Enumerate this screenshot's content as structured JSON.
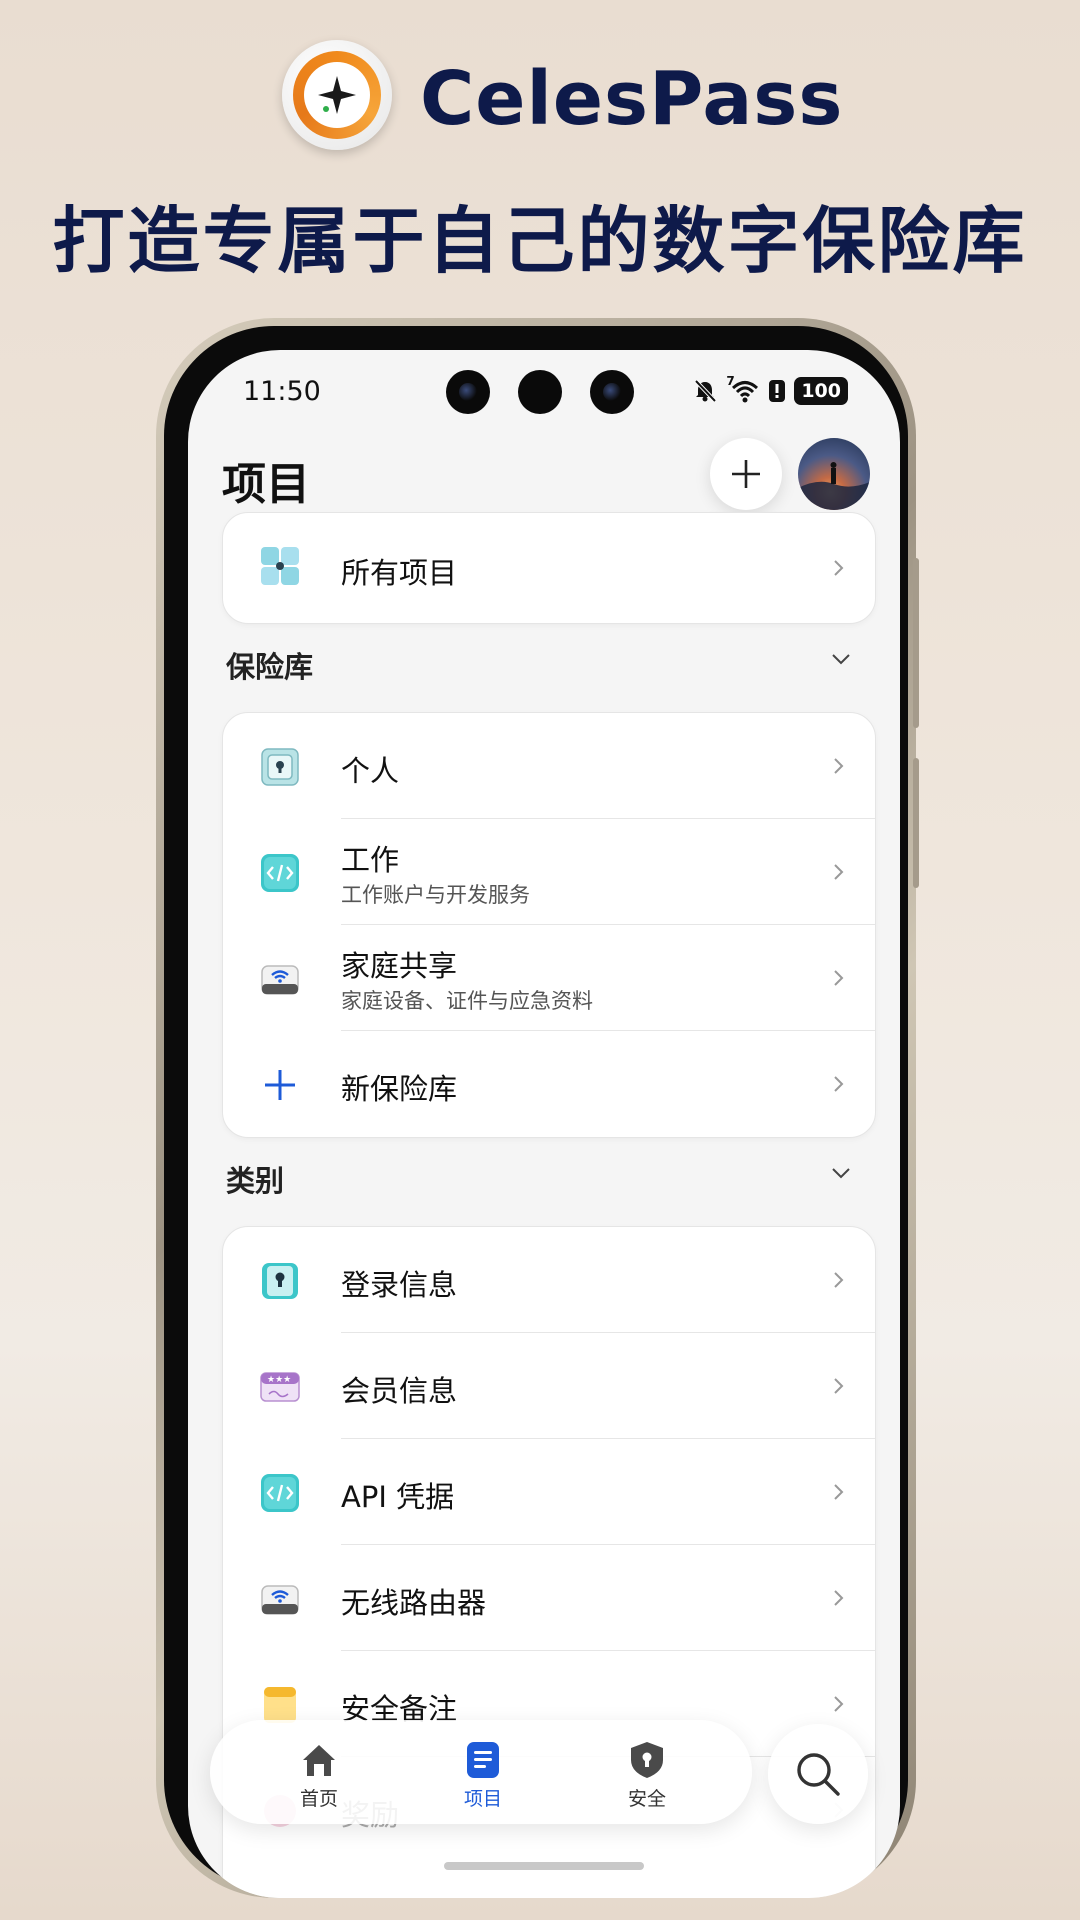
{
  "promo": {
    "brand": "CelesPass",
    "headline": "打造专属于自己的数字保险库"
  },
  "status": {
    "time": "11:50",
    "battery": "100",
    "signal_sup": "7"
  },
  "header": {
    "title": "项目"
  },
  "all_items": {
    "label": "所有项目",
    "icon": "grid-icon"
  },
  "vaults": {
    "heading": "保险库",
    "items": [
      {
        "label": "个人",
        "sub": "",
        "icon": "safe-icon"
      },
      {
        "label": "工作",
        "sub": "工作账户与开发服务",
        "icon": "code-icon"
      },
      {
        "label": "家庭共享",
        "sub": "家庭设备、证件与应急资料",
        "icon": "router-icon"
      },
      {
        "label": "新保险库",
        "sub": "",
        "icon": "plus-icon"
      }
    ]
  },
  "categories": {
    "heading": "类别",
    "items": [
      {
        "label": "登录信息",
        "icon": "keyhole-icon"
      },
      {
        "label": "会员信息",
        "icon": "membership-card-icon"
      },
      {
        "label": "API 凭据",
        "icon": "code-icon"
      },
      {
        "label": "无线路由器",
        "icon": "router-icon"
      },
      {
        "label": "安全备注",
        "icon": "note-icon"
      },
      {
        "label": "奖励",
        "icon": "gift-icon"
      }
    ]
  },
  "tabbar": {
    "tabs": [
      {
        "label": "首页",
        "icon": "home-icon"
      },
      {
        "label": "项目",
        "icon": "document-list-icon"
      },
      {
        "label": "安全",
        "icon": "shield-lock-icon"
      }
    ],
    "active_color": "#1e5bd8"
  },
  "colors": {
    "brand_navy": "#0e1a4a",
    "logo_orange": "#f08a1c",
    "accent_blue": "#1e5bd8",
    "teal": "#3cc6c9"
  }
}
